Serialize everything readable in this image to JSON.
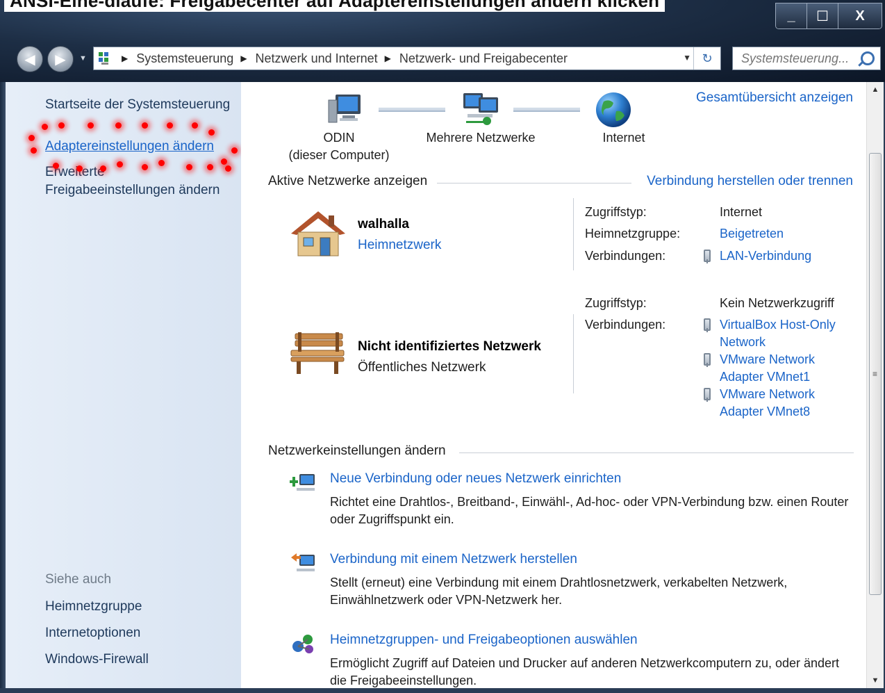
{
  "window": {
    "title": "ANSI-Eine-dlaufe: Freigabecenter auf Adaptereinstellungen ändern klicken",
    "min_glyph": "_",
    "max_glyph": "☐",
    "close_glyph": "X"
  },
  "address": {
    "crumbs": [
      "Systemsteuerung",
      "Netzwerk und Internet",
      "Netzwerk- und Freigabecenter"
    ],
    "search_placeholder": "Systemsteuerung..."
  },
  "left": {
    "home": "Startseite der Systemsteuerung",
    "adapter": "Adaptereinstellungen ändern",
    "advanced_line1": "Erweiterte",
    "advanced_line2": "Freigabeeinstellungen ändern",
    "see_also": "Siehe auch",
    "see_also_links": [
      "Heimnetzgruppe",
      "Internetoptionen",
      "Windows-Firewall"
    ]
  },
  "map": {
    "full_map_link": "Gesamtübersicht anzeigen",
    "computer_name": "ODIN",
    "computer_sub": "(dieser Computer)",
    "networks_label": "Mehrere Netzwerke",
    "internet_label": "Internet"
  },
  "active": {
    "heading": "Aktive Netzwerke anzeigen",
    "connect_link": "Verbindung herstellen oder trennen",
    "net1": {
      "name": "walhalla",
      "type": "Heimnetzwerk",
      "access_label": "Zugriffstyp:",
      "access_value": "Internet",
      "homegroup_label": "Heimnetzgruppe:",
      "homegroup_value": "Beigetreten",
      "conn_label": "Verbindungen:",
      "conn_value": "LAN-Verbindung"
    },
    "net2": {
      "name": "Nicht identifiziertes Netzwerk",
      "type": "Öffentliches Netzwerk",
      "access_label": "Zugriffstyp:",
      "access_value": "Kein Netzwerkzugriff",
      "conn_label": "Verbindungen:",
      "conns": [
        {
          "line1": "VirtualBox Host-Only",
          "line2": "Network"
        },
        {
          "line1": "VMware Network",
          "line2": "Adapter VMnet1"
        },
        {
          "line1": "VMware Network",
          "line2": "Adapter VMnet8"
        }
      ]
    }
  },
  "settings": {
    "heading": "Netzwerkeinstellungen ändern",
    "tasks": [
      {
        "link": "Neue Verbindung oder neues Netzwerk einrichten",
        "desc": "Richtet eine Drahtlos-, Breitband-, Einwähl-, Ad-hoc- oder VPN-Verbindung bzw. einen Router oder Zugriffspunkt ein."
      },
      {
        "link": "Verbindung mit einem Netzwerk herstellen",
        "desc": "Stellt (erneut) eine Verbindung mit einem Drahtlosnetzwerk, verkabelten Netzwerk, Einwählnetzwerk oder VPN-Netzwerk her."
      },
      {
        "link": "Heimnetzgruppen- und Freigabeoptionen auswählen",
        "desc": "Ermöglicht Zugriff auf Dateien und Drucker auf anderen Netzwerkcomputern zu, oder ändert die Freigabeeinstellungen."
      }
    ]
  },
  "colors": {
    "link": "#1a64c8",
    "leftpane": "#dfe8f4",
    "highlight_dots": "#ff0000"
  }
}
